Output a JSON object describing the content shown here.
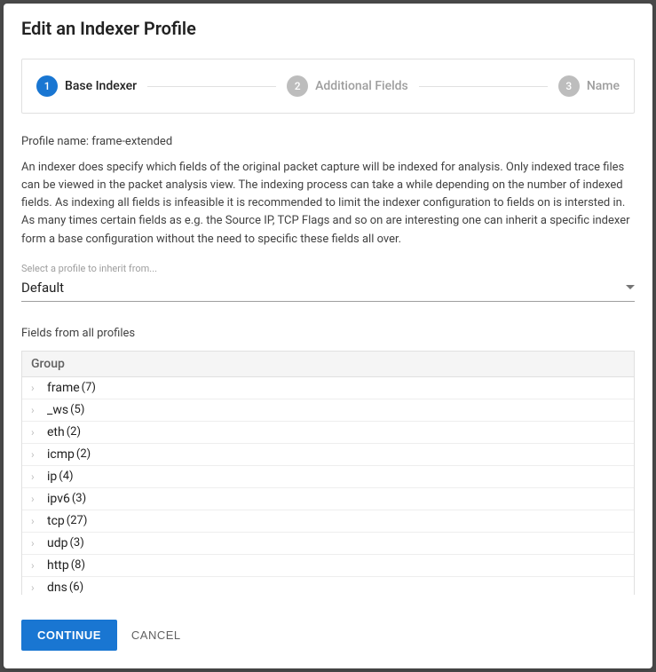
{
  "dialog": {
    "title": "Edit an Indexer Profile"
  },
  "stepper": {
    "steps": [
      {
        "num": "1",
        "label": "Base Indexer",
        "active": true
      },
      {
        "num": "2",
        "label": "Additional Fields",
        "active": false
      },
      {
        "num": "3",
        "label": "Name",
        "active": false
      }
    ]
  },
  "profile": {
    "name_label": "Profile name: frame-extended",
    "description": "An indexer does specify which fields of the original packet capture will be indexed for analysis. Only indexed trace files can be viewed in the packet analysis view. The indexing process can take a while depending on the number of indexed fields. As indexing all fields is infeasible it is recommended to limit the indexer configuration to fields on is intersted in. As many times certain fields as e.g. the Source IP, TCP Flags and so on are interesting one can inherit a specific indexer form a base configuration without the need to specific these fields all over."
  },
  "inherit_select": {
    "label": "Select a profile to inherit from...",
    "value": "Default"
  },
  "fields_section": {
    "label": "Fields from all profiles"
  },
  "table": {
    "header": "Group",
    "rows": [
      {
        "name": "frame",
        "count": "(7)"
      },
      {
        "name": "_ws",
        "count": "(5)"
      },
      {
        "name": "eth",
        "count": "(2)"
      },
      {
        "name": "icmp",
        "count": "(2)"
      },
      {
        "name": "ip",
        "count": "(4)"
      },
      {
        "name": "ipv6",
        "count": "(3)"
      },
      {
        "name": "tcp",
        "count": "(27)"
      },
      {
        "name": "udp",
        "count": "(3)"
      },
      {
        "name": "http",
        "count": "(8)"
      },
      {
        "name": "dns",
        "count": "(6)"
      }
    ]
  },
  "actions": {
    "continue": "CONTINUE",
    "cancel": "CANCEL"
  }
}
